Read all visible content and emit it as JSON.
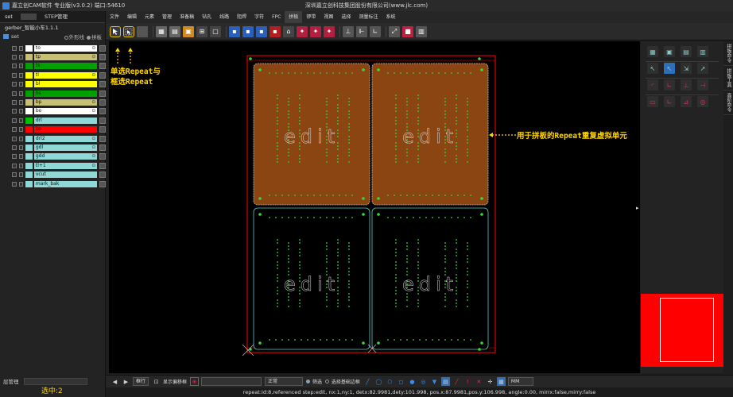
{
  "window": {
    "title": "嘉立创CAM软件 专业版(v3.0.2) 端口:54610",
    "company": "深圳嘉立创科技集团股份有限公司(www.jlc.com)"
  },
  "left_panel": {
    "tabs": [
      "set",
      "STEP管理"
    ],
    "job_name": "gerber_智能小车1.1.1",
    "step": {
      "name": "set",
      "opt_outline": "外形线",
      "opt_panel": "拼板"
    },
    "layers": [
      {
        "name": "to",
        "color": "#ffffff",
        "bg": "#ffffff",
        "eye": true
      },
      {
        "name": "tp",
        "color": "#c8c074",
        "bg": "#c8c074",
        "eye": true
      },
      {
        "name": "ts",
        "color": "#00a000",
        "bg": "#00a000",
        "eye": false
      },
      {
        "name": "tl",
        "color": "#ffff00",
        "bg": "#ffff00",
        "eye": true
      },
      {
        "name": "bl",
        "color": "#ffff00",
        "bg": "#ffff00",
        "eye": false
      },
      {
        "name": "bs",
        "color": "#00a000",
        "bg": "#00a000",
        "eye": false
      },
      {
        "name": "bp",
        "color": "#c8c074",
        "bg": "#c8c074",
        "eye": true
      },
      {
        "name": "bo",
        "color": "#ffffff",
        "bg": "#ffffff",
        "eye": true
      },
      {
        "name": "drl",
        "color": "#00c000",
        "bg": "#90d8d8",
        "eye": false
      },
      {
        "name": "ko",
        "color": "#ff0000",
        "bg": "#ff0000",
        "eye": false
      },
      {
        "name": "drl2",
        "color": "#90d8d8",
        "bg": "#90d8d8",
        "eye": true
      },
      {
        "name": "gdl",
        "color": "#90d8d8",
        "bg": "#90d8d8",
        "eye": true
      },
      {
        "name": "gdd",
        "color": "#90d8d8",
        "bg": "#90d8d8",
        "eye": true
      },
      {
        "name": "tl+1",
        "color": "#90d8d8",
        "bg": "#90d8d8",
        "eye": true
      },
      {
        "name": "vcut",
        "color": "#90d8d8",
        "bg": "#90d8d8",
        "eye": false
      },
      {
        "name": "mark_bak",
        "color": "#90d8d8",
        "bg": "#90d8d8",
        "eye": false
      }
    ],
    "layer_manager": "层管理",
    "selected_count": "选中:2"
  },
  "menu": [
    "文件",
    "编辑",
    "元素",
    "管理",
    "准备稿",
    "钻孔",
    "线路",
    "阻焊",
    "字符",
    "FPC",
    "拼板",
    "锣带",
    "视图",
    "选择",
    "测量标注",
    "系统"
  ],
  "menu_active": "拼板",
  "canvas": {
    "step_label": "edit",
    "colors": {
      "copper": "#8b4513",
      "outline": "#5ec8c8",
      "pads": "#33dd33",
      "profile": "#ff0000"
    }
  },
  "annotations": {
    "repeat_single": "单选Repeat与",
    "repeat_box": "框选Repeat",
    "repeat_desc": "用于拼板的Repeat重复虚拟单元"
  },
  "right_tabs": [
    "拼板命令",
    "拼板工具",
    "高阶命令"
  ],
  "bottom": {
    "mode": "框行",
    "display": "显示偏移框",
    "filter": "正常",
    "checkbox": "筛选",
    "select_layer": "选择基础边框",
    "unit": "MM"
  },
  "status": "repeat:id:8,referenced step:edit, nx:1,ny:1, detx:82.9981,dety:101.998, pos.x:87.9981,pos.y:106.998, angle:0.00, mirrx:false,mirry:false"
}
